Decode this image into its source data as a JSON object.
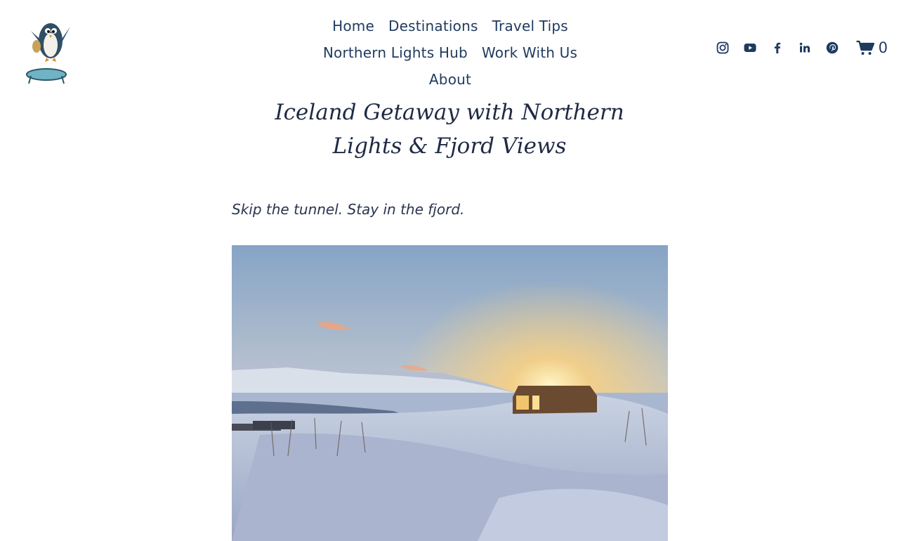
{
  "nav": {
    "row1": [
      "Home",
      "Destinations",
      "Travel Tips"
    ],
    "row2": [
      "Northern Lights Hub",
      "Work With Us"
    ],
    "row3": [
      "About"
    ]
  },
  "social": {
    "icons": [
      "instagram-icon",
      "youtube-icon",
      "facebook-icon",
      "linkedin-icon",
      "pinterest-icon"
    ]
  },
  "cart": {
    "count": "0",
    "icon": "cart-icon"
  },
  "article": {
    "title": "Iceland Getaway with Northern Lights & Fjord Views",
    "tagline": "Skip the tunnel. Stay in the fjord."
  },
  "colors": {
    "text": "#1f2a44",
    "link": "#1f3a5f",
    "background": "#ffffff"
  }
}
